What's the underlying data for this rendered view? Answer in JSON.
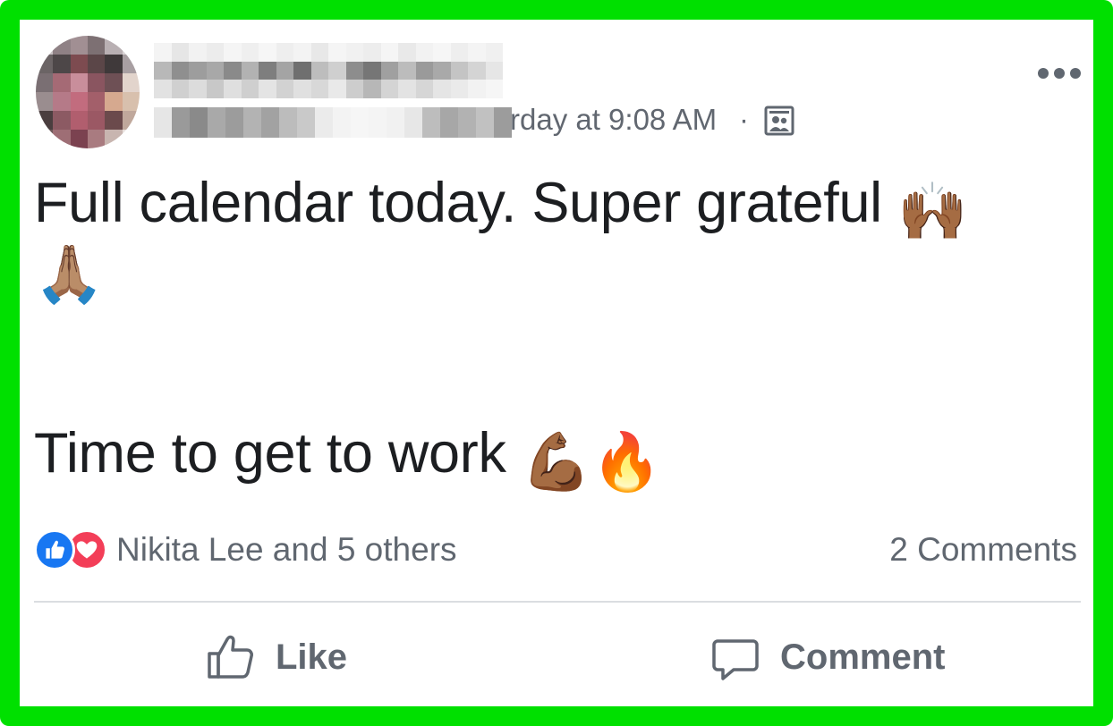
{
  "post": {
    "timestamp": "rday at 9:08 AM",
    "separator": "·",
    "audience_icon": "group-audience-icon",
    "more_icon": "more-options-icon",
    "text_line_1": "Full calendar today.  Super grateful",
    "text_line_1_emoji_1": "🙌🏾",
    "text_line_2_emoji": "🙏🏽",
    "text_line_3": "Time to get to work",
    "text_line_3_emoji_1": "💪🏾",
    "text_line_3_emoji_2": "🔥"
  },
  "reactions": {
    "icons": [
      "like-reaction-icon",
      "love-reaction-icon"
    ],
    "summary": "Nikita Lee and 5 others",
    "comments": "2 Comments"
  },
  "actions": {
    "like_label": "Like",
    "comment_label": "Comment"
  },
  "colors": {
    "frame": "#00e000",
    "like_blue": "#1877f2",
    "love_red": "#f33e58",
    "meta_gray": "#606770"
  }
}
